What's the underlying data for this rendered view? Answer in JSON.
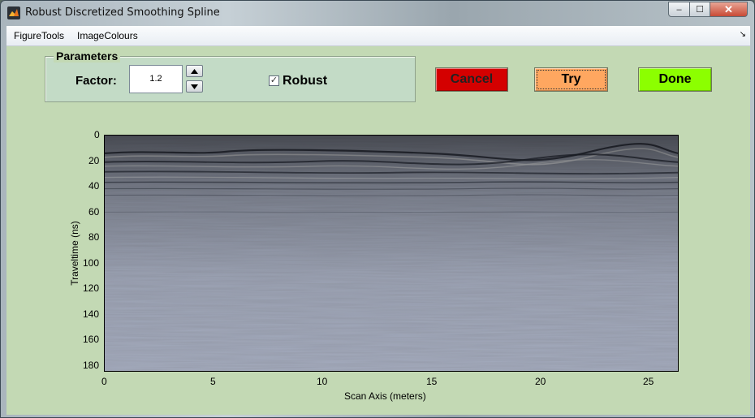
{
  "window": {
    "title": "Robust Discretized Smoothing Spline"
  },
  "window_buttons": {
    "minimize": "–",
    "maximize": "☐",
    "close": "✕"
  },
  "menu": {
    "items": [
      "FigureTools",
      "ImageColours"
    ],
    "dock_arrow": "↘"
  },
  "parameters": {
    "group_title": "Parameters",
    "factor_label": "Factor:",
    "factor_value": "1.2",
    "robust_label": "Robust",
    "robust_checked": true,
    "check_mark": "✓"
  },
  "buttons": {
    "cancel": "Cancel",
    "try": "Try",
    "done": "Done"
  },
  "colors": {
    "cancel": "#d40000",
    "try": "#ffa760",
    "done": "#8cff00",
    "background": "#c3d9b4"
  },
  "chart_data": {
    "type": "heatmap",
    "title": "",
    "xlabel": "Scan Axis (meters)",
    "ylabel": "Traveltime (ns)",
    "xlim": [
      0,
      26.3
    ],
    "ylim": [
      186,
      0
    ],
    "xticks": [
      0,
      5,
      10,
      15,
      20,
      25
    ],
    "yticks": [
      0,
      20,
      40,
      60,
      80,
      100,
      120,
      140,
      160,
      180
    ],
    "colormap": "gray",
    "grid": false
  }
}
